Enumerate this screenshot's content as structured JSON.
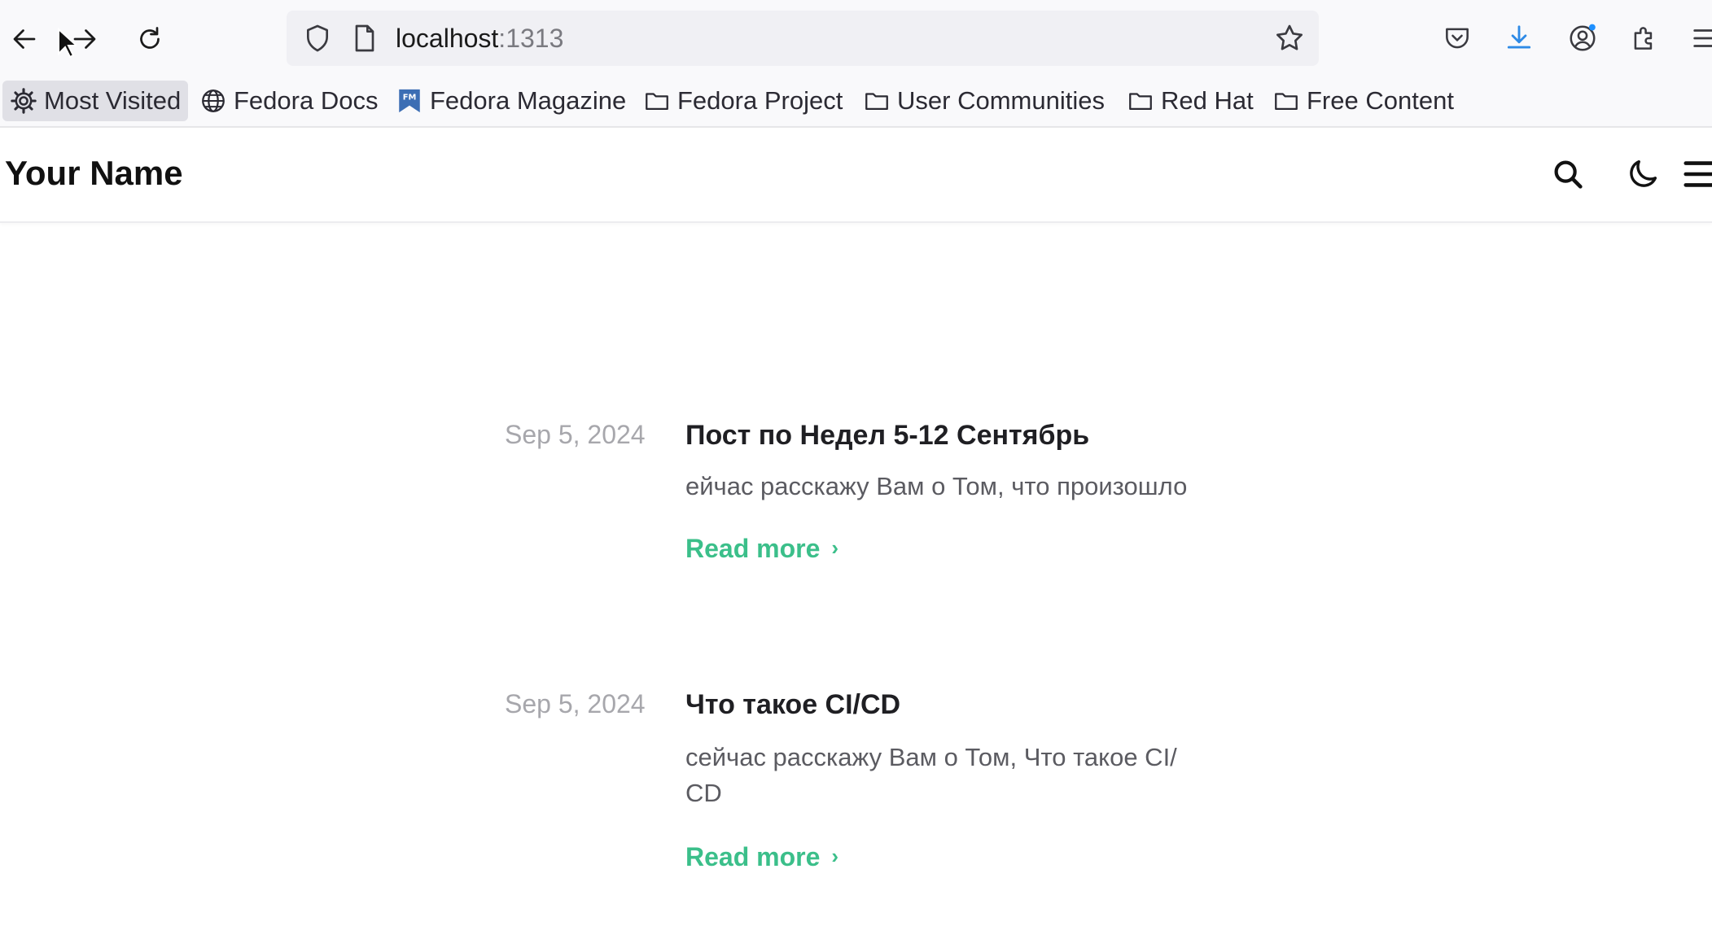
{
  "browser": {
    "url_host": "localhost",
    "url_port": ":1313",
    "bookmarks": [
      {
        "label": "Most Visited",
        "icon": "gear-icon"
      },
      {
        "label": "Fedora Docs",
        "icon": "globe-icon"
      },
      {
        "label": "Fedora Magazine",
        "icon": "fm-icon"
      },
      {
        "label": "Fedora Project",
        "icon": "folder-icon"
      },
      {
        "label": "User Communities",
        "icon": "folder-icon"
      },
      {
        "label": "Red Hat",
        "icon": "folder-icon"
      },
      {
        "label": "Free Content",
        "icon": "folder-icon"
      }
    ]
  },
  "site": {
    "title": "Your Name"
  },
  "posts": [
    {
      "date": "Sep 5, 2024",
      "title": "Пост по Недел 5-12 Сентябрь",
      "excerpt": "ейчас расскажу Вам о Том, что произошло",
      "read_more": "Read more"
    },
    {
      "date": "Sep 5, 2024",
      "title": "Что такое CI/CD",
      "excerpt": "сейчас расскажу Вам о Том, Что такое CI/ CD",
      "read_more": "Read more"
    }
  ],
  "colors": {
    "accent": "#3bbf8a",
    "download_badge": "#1e90ff"
  }
}
